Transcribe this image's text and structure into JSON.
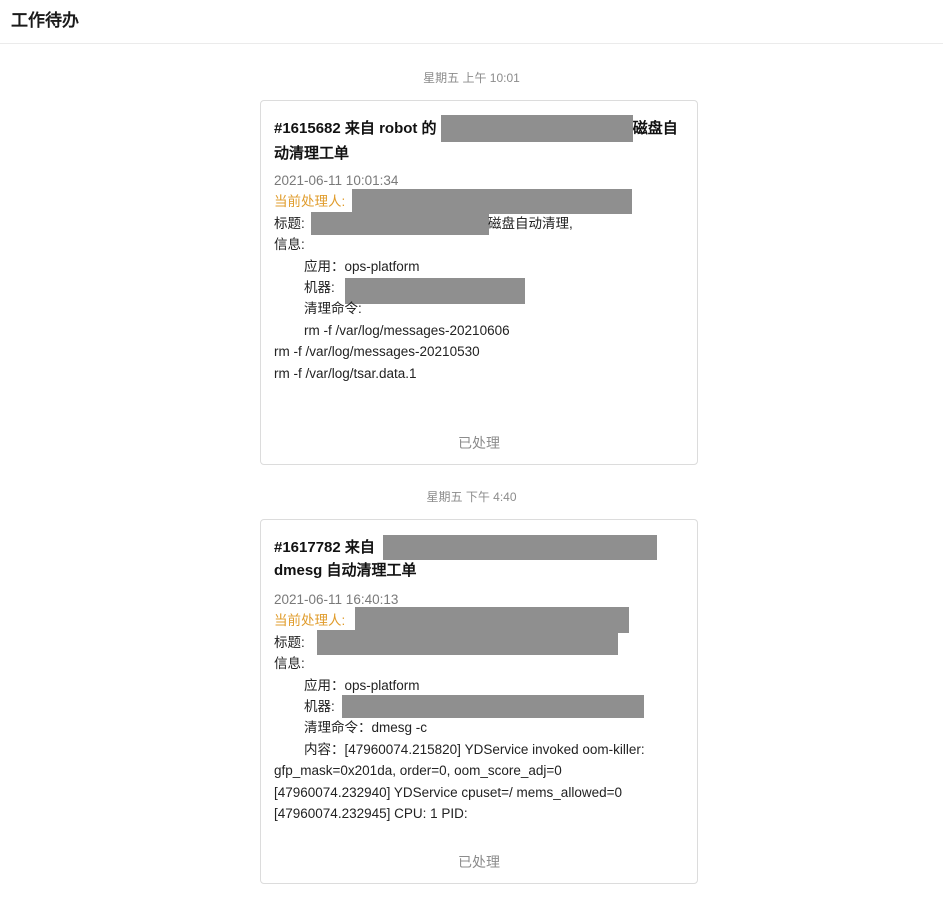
{
  "header": {
    "title": "工作待办"
  },
  "messages": [
    {
      "time": "星期五 上午 10:01",
      "title_prefix": "#1615682 来自 robot 的",
      "title_suffix": "磁盘自动清理工单",
      "date": "2021-06-11 10:01:34",
      "handler_label": "当前处理人:",
      "subject_label": "标题:",
      "subject_suffix": "磁盘自动清理,",
      "info_label": "信息:",
      "app_line": "应用：ops-platform",
      "machine_label": "机器:",
      "cmd_line": "清理命令:",
      "cmd_lines": [
        "rm -f /var/log/messages-20210606",
        "rm -f /var/log/messages-20210530",
        "rm -f /var/log/tsar.data.1"
      ],
      "status": "已处理"
    },
    {
      "time": "星期五 下午 4:40",
      "title_prefix": "#1617782 来自",
      "title_suffix": "dmesg 自动清理工单",
      "date": "2021-06-11 16:40:13",
      "handler_label": "当前处理人:",
      "subject_label": "标题:",
      "info_label": "信息:",
      "app_line": "应用：ops-platform",
      "machine_label": "机器:",
      "cmd_line": "清理命令：dmesg -c",
      "content_lines": [
        "内容：[47960074.215820] YDService invoked oom-killer:",
        "gfp_mask=0x201da, order=0, oom_score_adj=0",
        "[47960074.232940] YDService cpuset=/ mems_allowed=0",
        "[47960074.232945] CPU: 1 PID:"
      ],
      "status": "已处理"
    }
  ]
}
